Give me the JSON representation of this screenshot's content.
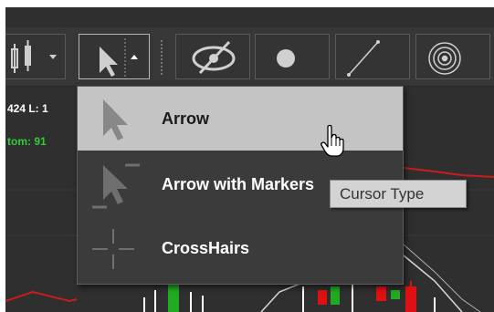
{
  "ticker_info": {
    "line1": "424  L: 1",
    "line2": "tom: 91"
  },
  "toolbar": {
    "buttons": [
      {
        "name": "chart-type-button",
        "icon": "candlestick-icon",
        "has_dropdown": true
      },
      {
        "name": "cursor-type-button",
        "icon": "arrow-cursor-icon",
        "has_dropdown": true,
        "active": true
      },
      {
        "name": "hide-drawings-button",
        "icon": "eye-slash-icon"
      },
      {
        "name": "dot-tool-button",
        "icon": "dot-icon"
      },
      {
        "name": "line-tool-button",
        "icon": "line-icon"
      },
      {
        "name": "circle-tool-button",
        "icon": "concentric-circles-icon"
      }
    ]
  },
  "cursor_menu": {
    "items": [
      {
        "label": "Arrow",
        "icon": "arrow-icon",
        "highlighted": true
      },
      {
        "label": "Arrow with Markers",
        "icon": "arrow-with-markers-icon",
        "highlighted": false
      },
      {
        "label": "CrossHairs",
        "icon": "crosshairs-icon",
        "highlighted": false
      }
    ]
  },
  "tooltip": {
    "text": "Cursor Type"
  },
  "colors": {
    "toolbar_bg": "#373737",
    "menu_bg": "#3b3b3b",
    "menu_highlight": "#c4c4c4",
    "candle_up": "#22aa22",
    "candle_down": "#dd1111",
    "info_white": "#ffffff",
    "info_green": "#33cc33"
  }
}
